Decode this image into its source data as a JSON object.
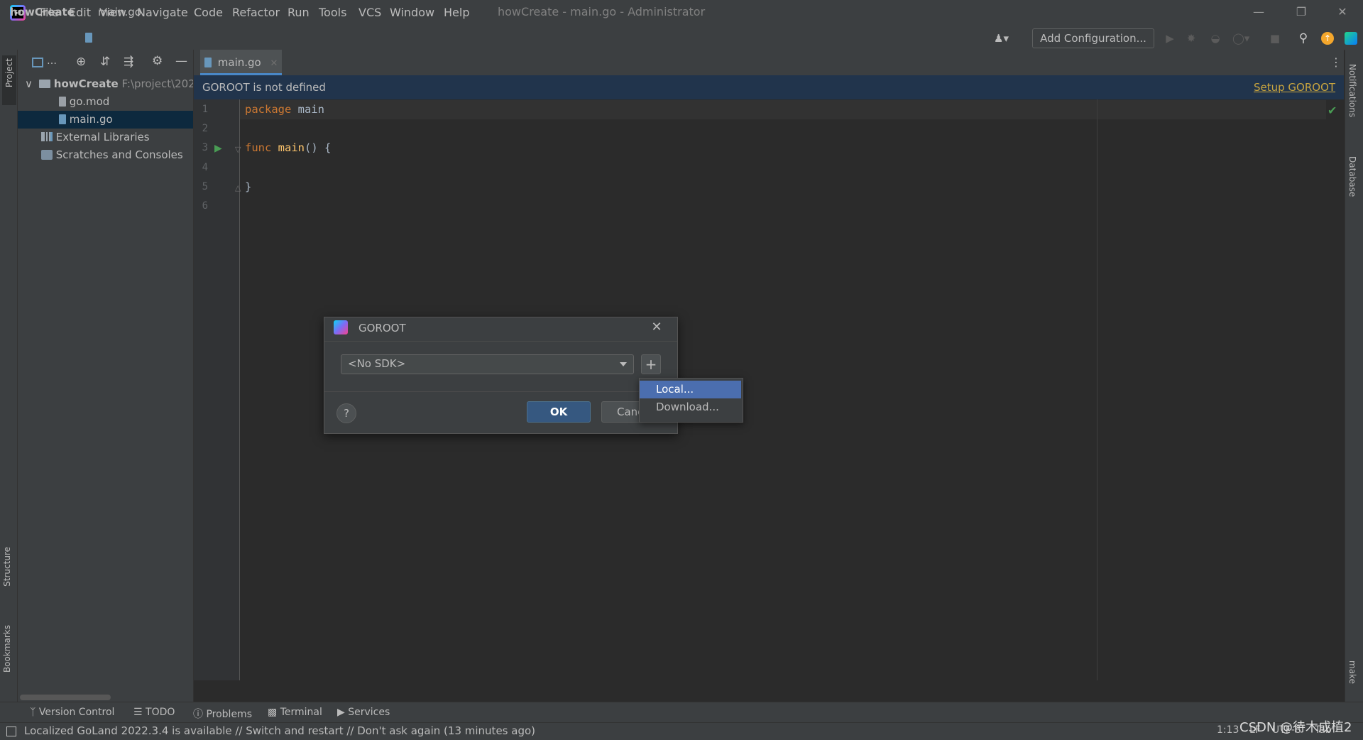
{
  "app": {
    "window_title": "howCreate - main.go - Administrator",
    "logo_text": "GO"
  },
  "menu": [
    "File",
    "Edit",
    "View",
    "Navigate",
    "Code",
    "Refactor",
    "Run",
    "Tools",
    "VCS",
    "Window",
    "Help"
  ],
  "breadcrumb": {
    "project": "howCreate",
    "file": "main.go"
  },
  "toolbar": {
    "add_configuration": "Add Configuration..."
  },
  "project_tree": {
    "root_name": "howCreate",
    "root_path": "F:\\project\\202",
    "items": [
      "go.mod",
      "main.go"
    ],
    "external_libraries": "External Libraries",
    "scratches": "Scratches and Consoles"
  },
  "left_strip": {
    "project": "Project",
    "structure": "Structure",
    "bookmarks": "Bookmarks"
  },
  "right_strip": {
    "notifications": "Notifications",
    "database": "Database",
    "make": "make"
  },
  "editor": {
    "tab": "main.go",
    "banner_text": "GOROOT is not defined",
    "banner_link": "Setup GOROOT",
    "line_numbers": [
      "1",
      "2",
      "3",
      "4",
      "5",
      "6"
    ],
    "lines": [
      {
        "kw": "package",
        "rest": " main"
      },
      {
        "kw": "",
        "rest": ""
      },
      {
        "kw": "func",
        "fn": "main",
        "rest": "() {"
      },
      {
        "kw": "",
        "rest": ""
      },
      {
        "kw": "",
        "rest": "}"
      },
      {
        "kw": "",
        "rest": ""
      }
    ]
  },
  "dialog": {
    "title": "GOROOT",
    "sdk_value": "<No SDK>",
    "ok": "OK",
    "cancel": "Cancel",
    "help": "?",
    "add": "+"
  },
  "popup": {
    "items": [
      "Local...",
      "Download..."
    ],
    "selected_index": 0
  },
  "bottom_tools": [
    "Version Control",
    "TODO",
    "Problems",
    "Terminal",
    "Services"
  ],
  "status": {
    "message": "Localized GoLand 2022.3.4 is available // Switch and restart // Don't ask again (13 minutes ago)",
    "position": "1:13",
    "line_ending": "LF",
    "encoding": "UTF-8",
    "indent": "Tab"
  },
  "watermark": "CSDN @待木成植2",
  "colors": {
    "accent": "#4b6eaf",
    "banner": "#21344c",
    "keyword": "#cc7832",
    "function": "#ffc66d",
    "link": "#c9a53f"
  }
}
